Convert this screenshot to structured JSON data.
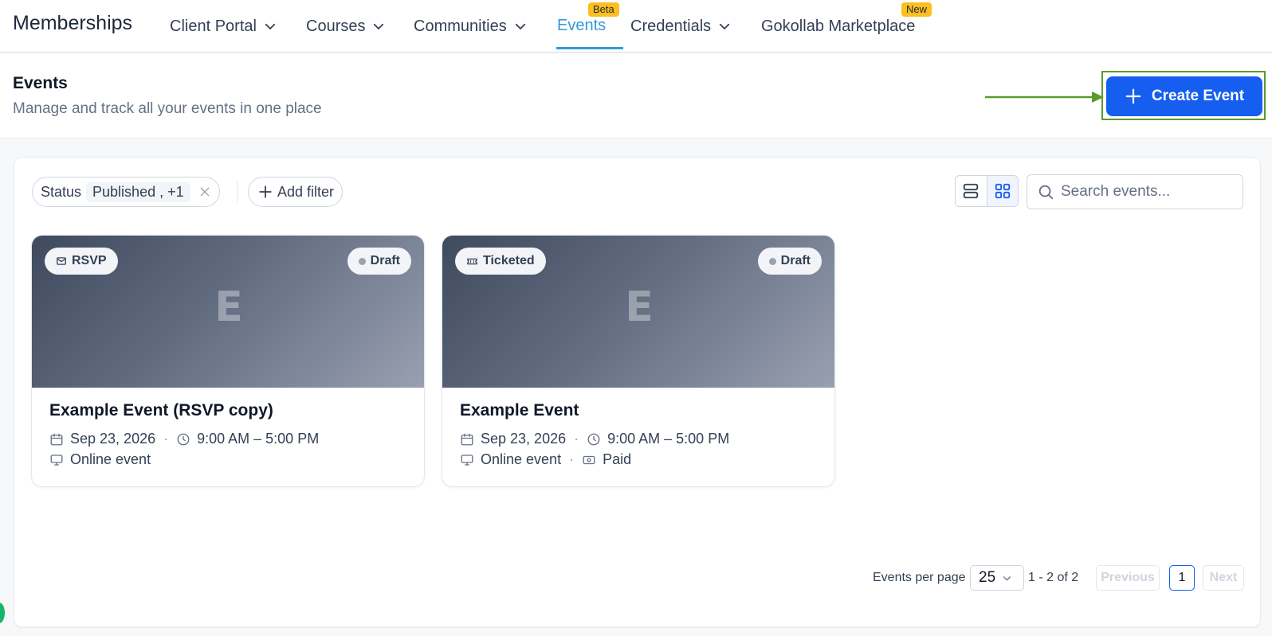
{
  "app": {
    "title": "Memberships"
  },
  "nav": {
    "items": [
      {
        "label": "Client Portal",
        "has_dropdown": true
      },
      {
        "label": "Courses",
        "has_dropdown": true
      },
      {
        "label": "Communities",
        "has_dropdown": true
      },
      {
        "label": "Events",
        "badge": "Beta",
        "active": true
      },
      {
        "label": "Credentials",
        "has_dropdown": true
      },
      {
        "label": "Gokollab Marketplace",
        "badge": "New"
      }
    ]
  },
  "header": {
    "title": "Events",
    "subtitle": "Manage and track all your events in one place",
    "create_button": "Create Event"
  },
  "filters": {
    "status_label": "Status",
    "status_values": "Published , +1",
    "add_filter": "Add filter"
  },
  "view": {
    "modes": [
      "list-view-icon",
      "grid-view-icon"
    ],
    "selected": "grid-view-icon"
  },
  "search": {
    "placeholder": "Search events..."
  },
  "events": [
    {
      "type_label": "RSVP",
      "type_icon": "mail-icon",
      "status": "Draft",
      "initial": "E",
      "title": "Example Event (RSVP copy)",
      "date": "Sep 23, 2026",
      "time": "9:00 AM – 5:00 PM",
      "location": "Online event"
    },
    {
      "type_label": "Ticketed",
      "type_icon": "ticket-icon",
      "status": "Draft",
      "initial": "E",
      "title": "Example Event",
      "date": "Sep 23, 2026",
      "time": "9:00 AM – 5:00 PM",
      "location": "Online event",
      "price": "Paid"
    }
  ],
  "pagination": {
    "per_page_label": "Events per page",
    "per_page": "25",
    "range": "1 - 2 of 2",
    "previous": "Previous",
    "current_page": "1",
    "next": "Next"
  },
  "colors": {
    "primary": "#155eef",
    "nav_active": "#2e9bd6",
    "badge": "#fdbf1e",
    "highlight_outline": "#5a9a2a"
  }
}
